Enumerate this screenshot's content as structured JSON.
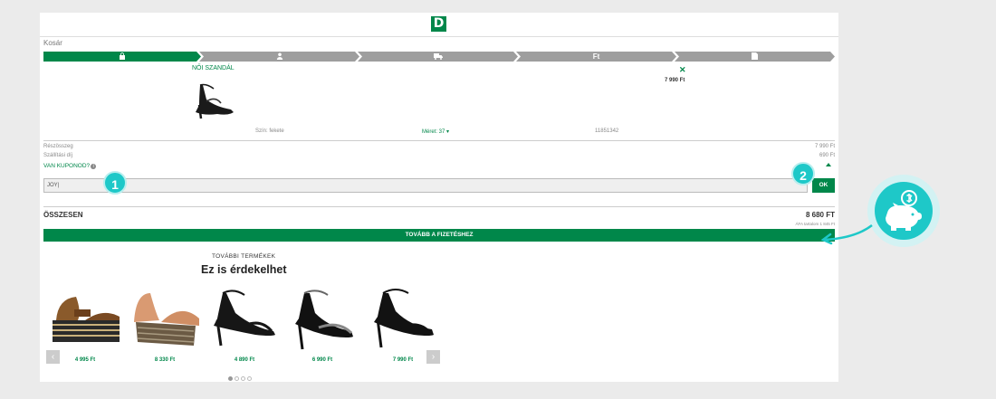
{
  "logo": {
    "letter": "D"
  },
  "breadcrumb": "Kosár",
  "steps": {
    "price_label": "Ft"
  },
  "product": {
    "title": "NŐI SZANDÁL",
    "price": "7 990 Ft",
    "remove_icon": "close-icon",
    "color_label": "Szín: fekete",
    "size_label": "Méret: 37 ▾",
    "sku": "11851342"
  },
  "summary": {
    "subtotal_label": "Részösszeg",
    "subtotal_value": "7 990 Ft",
    "shipping_label": "Szállítási díj",
    "shipping_value": "690 Ft",
    "coupon_link": "VAN KUPONOD?",
    "info_icon": "i"
  },
  "coupon": {
    "value": "JOY|",
    "ok_label": "OK"
  },
  "total": {
    "label": "ÖSSZESEN",
    "value": "8 680 FT",
    "vat_note": "ÁFA tartalom 1 845 Ft"
  },
  "checkout": {
    "label": "TOVÁBB A FIZETÉSHEZ"
  },
  "recommendations": {
    "eyebrow": "TOVÁBBI TERMÉKEK",
    "title": "Ez is érdekelhet",
    "items": [
      {
        "price": "4 995 Ft"
      },
      {
        "price": "8 330 Ft"
      },
      {
        "price": "4 890 Ft"
      },
      {
        "price": "6 990 Ft"
      },
      {
        "price": "7 990 Ft"
      }
    ],
    "prev": "‹",
    "next": "›"
  },
  "annotations": {
    "badge1": "1",
    "badge2": "2"
  },
  "colors": {
    "brand": "#00874a",
    "accent": "#1ec8c8",
    "step_inactive": "#9e9e9e"
  }
}
